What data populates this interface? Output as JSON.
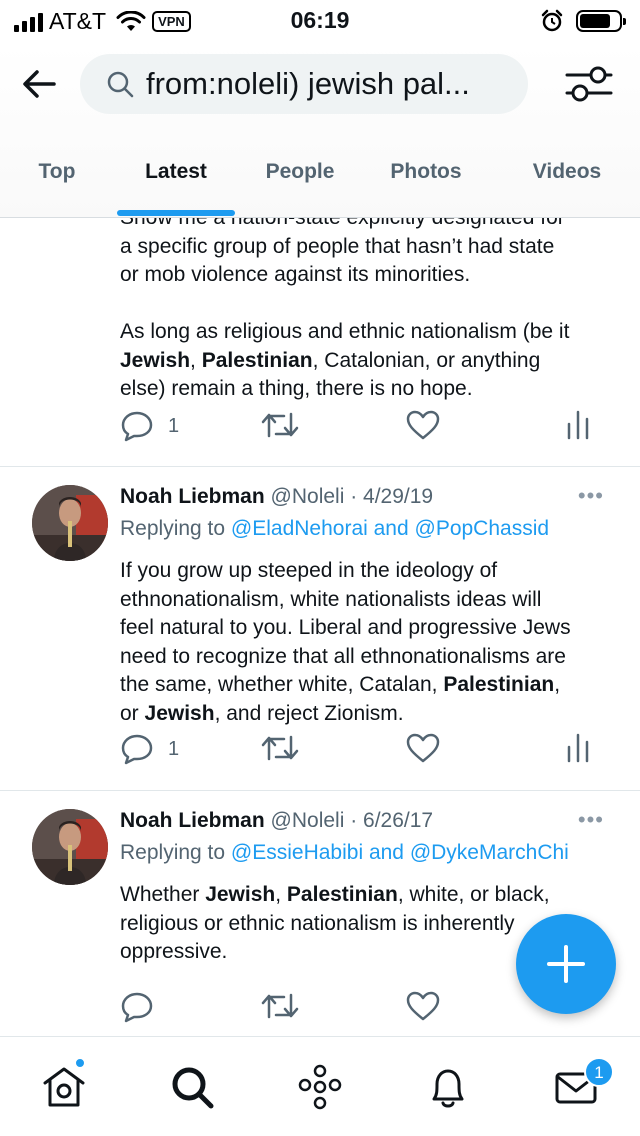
{
  "status_bar": {
    "carrier": "AT&T",
    "vpn_label": "VPN",
    "time": "06:19",
    "battery_level": 0.8
  },
  "header": {
    "search_query": "from:noleli) jewish pal...",
    "tabs": [
      "Top",
      "Latest",
      "People",
      "Photos",
      "Videos"
    ],
    "active_tab": "Latest"
  },
  "feed": {
    "partial_tweet": {
      "lines": [
        "Show me a nation-state explicitly designated for",
        "a specific group of people that hasn’t had state",
        "or mob violence against its minorities."
      ],
      "para2": {
        "l1": "As long as religious and ethnic nationalism (be it",
        "l2_bold1": "Jewish",
        "l2_sep1": ", ",
        "l2_bold2": "Palestinian",
        "l2_rest": ", Catalonian, or anything",
        "l3": "else) remain a thing, there is no hope."
      },
      "reply_count": "1"
    },
    "tweets": [
      {
        "name": "Noah Liebman",
        "handle": "@Noleli",
        "date": "· 4/29/19",
        "more": "•••",
        "replying_prefix": "Replying to",
        "replying_to": "@EladNehorai and @PopChassid",
        "text": {
          "l1": "If you grow up steeped in the ideology of",
          "l2": "ethnonationalism, white nationalists ideas will",
          "l3": "feel natural to you. Liberal and progressive Jews",
          "l4": "need to recognize that all ethnonationalisms are",
          "l5_pre": "the same, whether white, Catalan, ",
          "l5_bold": "Palestinian",
          "l5_post": ",",
          "l6_pre": "or ",
          "l6_bold": "Jewish",
          "l6_post": ", and reject Zionism."
        },
        "reply_count": "1"
      },
      {
        "name": "Noah Liebman",
        "handle": "@Noleli",
        "date": "· 6/26/17",
        "more": "•••",
        "replying_prefix": "Replying to",
        "replying_to": "@EssieHabibi and @DykeMarchChi",
        "text": {
          "l1_pre": "Whether ",
          "l1_bold1": "Jewish",
          "l1_sep": ", ",
          "l1_bold2": "Palestinian",
          "l1_post": ", white, or black,",
          "l2": "religious or ethnic nationalism is inherently",
          "l3": "oppressive."
        }
      }
    ]
  },
  "tabbar": {
    "messages_badge": "1"
  },
  "colors": {
    "accent": "#1d9bf0",
    "text": "#0f1419",
    "muted": "#536471"
  }
}
